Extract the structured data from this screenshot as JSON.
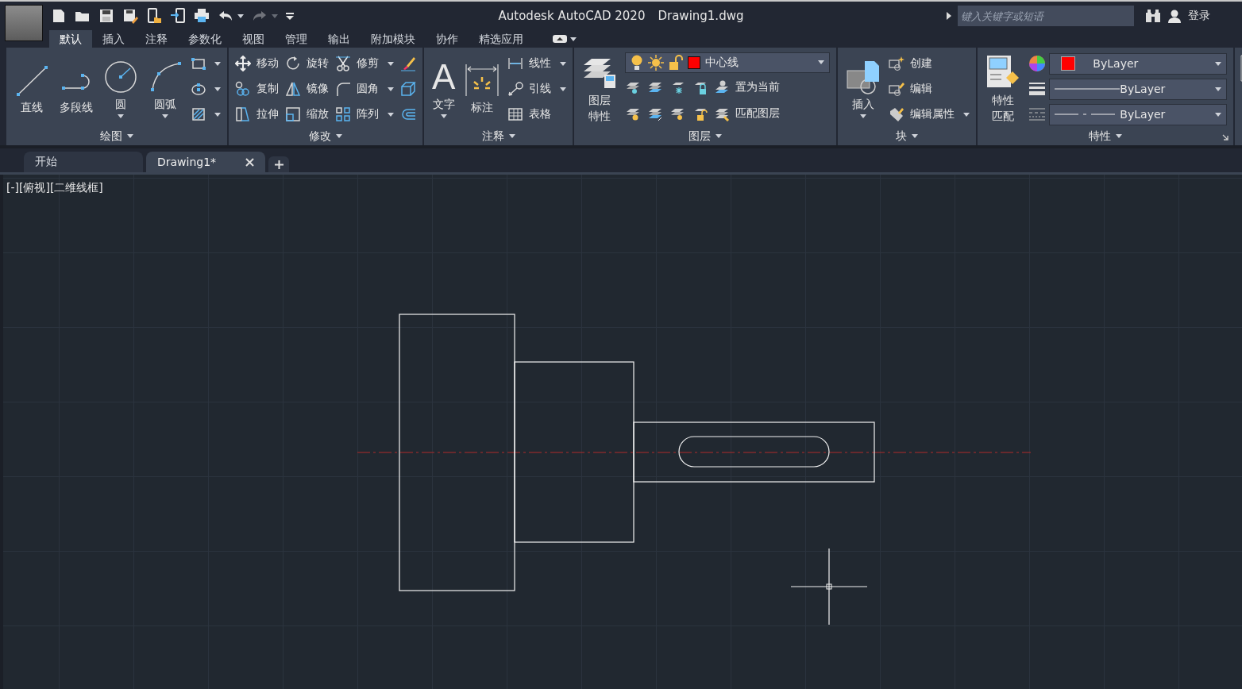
{
  "quick_access": [
    {
      "dropdown": false,
      "disabled": false
    },
    {
      "dropdown": false,
      "disabled": false
    },
    {
      "dropdown": false,
      "disabled": false
    },
    {
      "dropdown": false,
      "disabled": false
    },
    {
      "dropdown": false,
      "disabled": false
    },
    {
      "dropdown": false,
      "disabled": false
    },
    {
      "dropdown": false,
      "disabled": false
    },
    {
      "dropdown": true,
      "disabled": false
    },
    {
      "dropdown": true,
      "disabled": true
    }
  ],
  "title": {
    "app": "Autodesk AutoCAD 2020",
    "file": "Drawing1.dwg"
  },
  "search": {
    "placeholder": "键入关键字或短语"
  },
  "sign_in": "登录",
  "ribbon_tabs": [
    {
      "label": "默认",
      "selected": true
    },
    {
      "label": "插入",
      "selected": false
    },
    {
      "label": "注释",
      "selected": false
    },
    {
      "label": "参数化",
      "selected": false
    },
    {
      "label": "视图",
      "selected": false
    },
    {
      "label": "管理",
      "selected": false
    },
    {
      "label": "输出",
      "selected": false
    },
    {
      "label": "附加模块",
      "selected": false
    },
    {
      "label": "协作",
      "selected": false
    },
    {
      "label": "精选应用",
      "selected": false
    }
  ],
  "panels": [
    {
      "title": "绘图",
      "menu": true,
      "launcher": false,
      "columns": [
        {
          "items": [
            {
              "kind": "large",
              "label": "直线",
              "dropdown": false,
              "wrap": false
            }
          ]
        },
        {
          "items": [
            {
              "kind": "large",
              "label": "多段线",
              "dropdown": false,
              "wrap": false
            }
          ]
        },
        {
          "items": [
            {
              "kind": "large",
              "label": "圆",
              "dropdown": true,
              "wrap": false
            }
          ]
        },
        {
          "items": [
            {
              "kind": "large",
              "label": "圆弧",
              "dropdown": true,
              "wrap": false
            }
          ]
        },
        {
          "items": [
            {
              "kind": "icon",
              "dropdown": true
            },
            {
              "kind": "icon",
              "dropdown": true
            },
            {
              "kind": "icon",
              "dropdown": true
            }
          ]
        }
      ]
    },
    {
      "title": "修改",
      "menu": true,
      "launcher": false,
      "columns": [
        {
          "items": [
            {
              "kind": "small",
              "label": "移动",
              "dropdown": false
            },
            {
              "kind": "small",
              "label": "复制",
              "dropdown": false
            },
            {
              "kind": "small",
              "label": "拉伸",
              "dropdown": false
            }
          ]
        },
        {
          "items": [
            {
              "kind": "small",
              "label": "旋转",
              "dropdown": false
            },
            {
              "kind": "small",
              "label": "镜像",
              "dropdown": false
            },
            {
              "kind": "small",
              "label": "缩放",
              "dropdown": false
            }
          ]
        },
        {
          "items": [
            {
              "kind": "small",
              "label": "修剪",
              "dropdown": true
            },
            {
              "kind": "small",
              "label": "圆角",
              "dropdown": true
            },
            {
              "kind": "small",
              "label": "阵列",
              "dropdown": true
            }
          ]
        },
        {
          "items": [
            {
              "kind": "icon",
              "dropdown": false
            },
            {
              "kind": "icon",
              "dropdown": false
            },
            {
              "kind": "icon",
              "dropdown": false
            }
          ]
        }
      ]
    },
    {
      "title": "注释",
      "menu": true,
      "launcher": false,
      "columns": [
        {
          "items": [
            {
              "kind": "large",
              "label": "文字",
              "glyph": "A",
              "dropdown": true,
              "wrap": false
            }
          ]
        },
        {
          "items": [
            {
              "kind": "large",
              "label": "标注",
              "dropdown": false,
              "wrap": false
            }
          ]
        },
        {
          "items": [
            {
              "kind": "small",
              "label": "线性",
              "dropdown": true
            },
            {
              "kind": "small",
              "label": "引线",
              "dropdown": true
            },
            {
              "kind": "small",
              "label": "表格",
              "dropdown": false
            }
          ]
        }
      ]
    },
    {
      "title": "图层",
      "menu": true,
      "launcher": false,
      "columns": [
        {
          "items": [
            {
              "kind": "large",
              "label": "图层特性",
              "dropdown": false,
              "wrap": true
            }
          ]
        },
        {
          "items": [
            {
              "kind": "layer_select",
              "label": "中心线",
              "color": "#ff0000"
            },
            {
              "kind": "row",
              "items": [
                {
                  "kind": "icon",
                  "dropdown": false
                },
                {
                  "kind": "icon",
                  "dropdown": false
                },
                {
                  "kind": "icon",
                  "dropdown": false
                },
                {
                  "kind": "icon",
                  "dropdown": false
                },
                {
                  "kind": "small",
                  "label": "置为当前",
                  "dropdown": false
                }
              ]
            },
            {
              "kind": "row",
              "items": [
                {
                  "kind": "icon",
                  "dropdown": false
                },
                {
                  "kind": "icon",
                  "dropdown": false
                },
                {
                  "kind": "icon",
                  "dropdown": false
                },
                {
                  "kind": "icon",
                  "dropdown": false
                },
                {
                  "kind": "small",
                  "label": "匹配图层",
                  "dropdown": false
                }
              ]
            }
          ]
        }
      ]
    },
    {
      "title": "块",
      "menu": true,
      "launcher": false,
      "columns": [
        {
          "items": [
            {
              "kind": "large",
              "label": "插入",
              "dropdown": true,
              "wrap": false
            }
          ]
        },
        {
          "items": [
            {
              "kind": "small",
              "label": "创建",
              "dropdown": false
            },
            {
              "kind": "small",
              "label": "编辑",
              "dropdown": false
            },
            {
              "kind": "small",
              "label": "编辑属性",
              "dropdown": true
            }
          ]
        }
      ]
    },
    {
      "title": "特性",
      "menu": true,
      "launcher": true,
      "columns": [
        {
          "items": [
            {
              "kind": "large",
              "label": "特性匹配",
              "dropdown": false,
              "wrap": true
            }
          ]
        },
        {
          "items": [
            {
              "kind": "color_select",
              "color": "#ff0000",
              "label": "ByLayer"
            },
            {
              "kind": "lineweight_select",
              "label": "ByLayer"
            },
            {
              "kind": "linetype_select",
              "label": "ByLayer"
            }
          ]
        }
      ]
    }
  ],
  "doc_tabs": [
    {
      "label": "开始",
      "selected": false,
      "closable": false
    },
    {
      "label": "Drawing1*",
      "selected": true,
      "closable": true
    }
  ],
  "viewport_label": "[-][俯视][二维线框]"
}
